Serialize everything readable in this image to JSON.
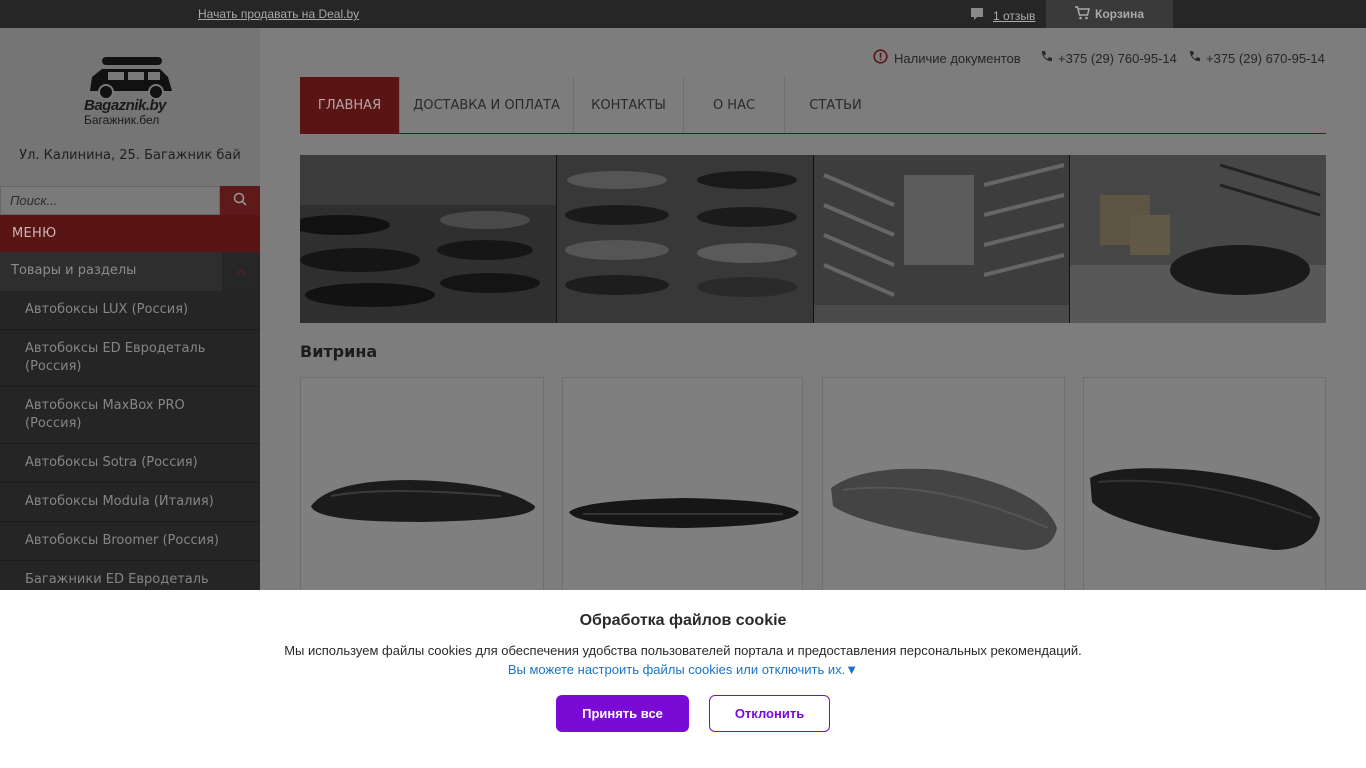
{
  "topbar": {
    "sell_link": "Начать продавать на Deal.by",
    "reviews": "1 отзыв",
    "cart": "Корзина"
  },
  "sidebar": {
    "logo_line1": "Bagaznik.by",
    "logo_line2": "Багажник.бел",
    "address": "Ул. Калинина, 25. Багажник бай",
    "search_placeholder": "Поиск...",
    "menu_title": "МЕНЮ",
    "categories_head": "Товары и разделы",
    "categories": [
      "Автобоксы LUX (Россия)",
      "Автобоксы ED Евродеталь (Россия)",
      "Автобоксы MaxBox PRO (Россия)",
      "Автобоксы Sotra (Россия)",
      "Автобоксы Modula (Италия)",
      "Автобоксы Broomer (Россия)",
      "Багажники ED Евродеталь"
    ]
  },
  "header": {
    "documents": "Наличие документов",
    "phone1": "+375 (29) 760-95-14",
    "phone2": "+375 (29) 670-95-14"
  },
  "nav": [
    "Главная",
    "Доставка и оплата",
    "Контакты",
    "О нас",
    "Статьи"
  ],
  "main": {
    "section_title": "Витрина"
  },
  "cookie": {
    "title": "Обработка файлов cookie",
    "message": "Мы используем файлы cookies для обеспечения удобства пользователей портала и предоставления персональных рекомендаций.",
    "settings_link": "Вы можете настроить файлы cookies или отключить их.▼",
    "accept": "Принять все",
    "decline": "Отклонить"
  },
  "colors": {
    "accent_red": "#c8262b",
    "cookie_purple": "#7a0ad6",
    "link_blue": "#1a73c9"
  }
}
